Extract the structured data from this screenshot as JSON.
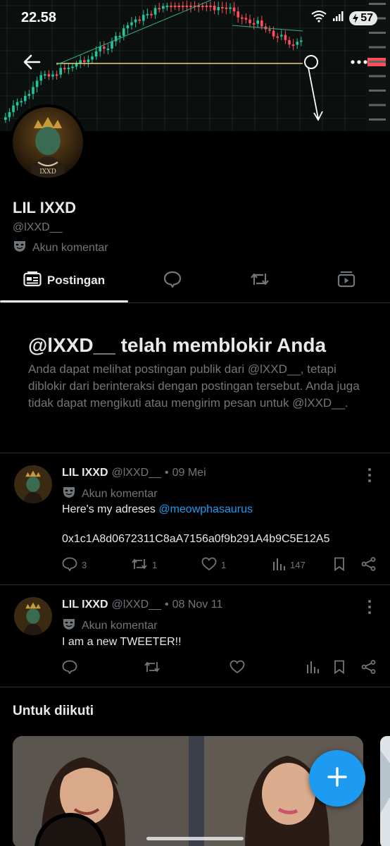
{
  "status_bar": {
    "time": "22.58",
    "battery": "57"
  },
  "profile": {
    "name": "LIL IXXD",
    "handle": "@lXXD__",
    "badge_label": "Akun komentar",
    "avatar_text": "IXXD"
  },
  "tabs": [
    {
      "label": "Postingan",
      "icon": "posts-icon",
      "active": true
    },
    {
      "label": "",
      "icon": "reply-icon"
    },
    {
      "label": "",
      "icon": "repost-icon"
    },
    {
      "label": "",
      "icon": "media-icon"
    }
  ],
  "blocked": {
    "title": "@lXXD__ telah memblokir Anda",
    "text": "Anda dapat melihat postingan publik dari @lXXD__, tetapi diblokir dari berinteraksi dengan postingan tersebut. Anda juga tidak dapat mengikuti atau mengirim pesan untuk @lXXD__."
  },
  "tweets": [
    {
      "name": "LIL IXXD",
      "handle": "@lXXD__",
      "date": "09 Mei",
      "badge": "Akun komentar",
      "text_prefix": "Here's my adreses ",
      "mention": "@meowphasaurus",
      "text_line2": "0x1c1A8d0672311C8aA7156a0f9b291A4b9C5E12A5",
      "replies": "3",
      "reposts": "1",
      "likes": "1",
      "views": "147"
    },
    {
      "name": "LIL IXXD",
      "handle": "@lXXD__",
      "date": "08 Nov 11",
      "badge": "Akun komentar",
      "text": "I am a new TWEETER!!",
      "replies": "",
      "reposts": "",
      "likes": "",
      "views": ""
    }
  ],
  "follow": {
    "title": "Untuk diikuti"
  },
  "colors": {
    "accent": "#1d9bf0",
    "background": "#000000",
    "muted": "#71767b",
    "text": "#e7e9ea",
    "chart_up": "#1fc7a0",
    "chart_down": "#ff4d5a"
  }
}
